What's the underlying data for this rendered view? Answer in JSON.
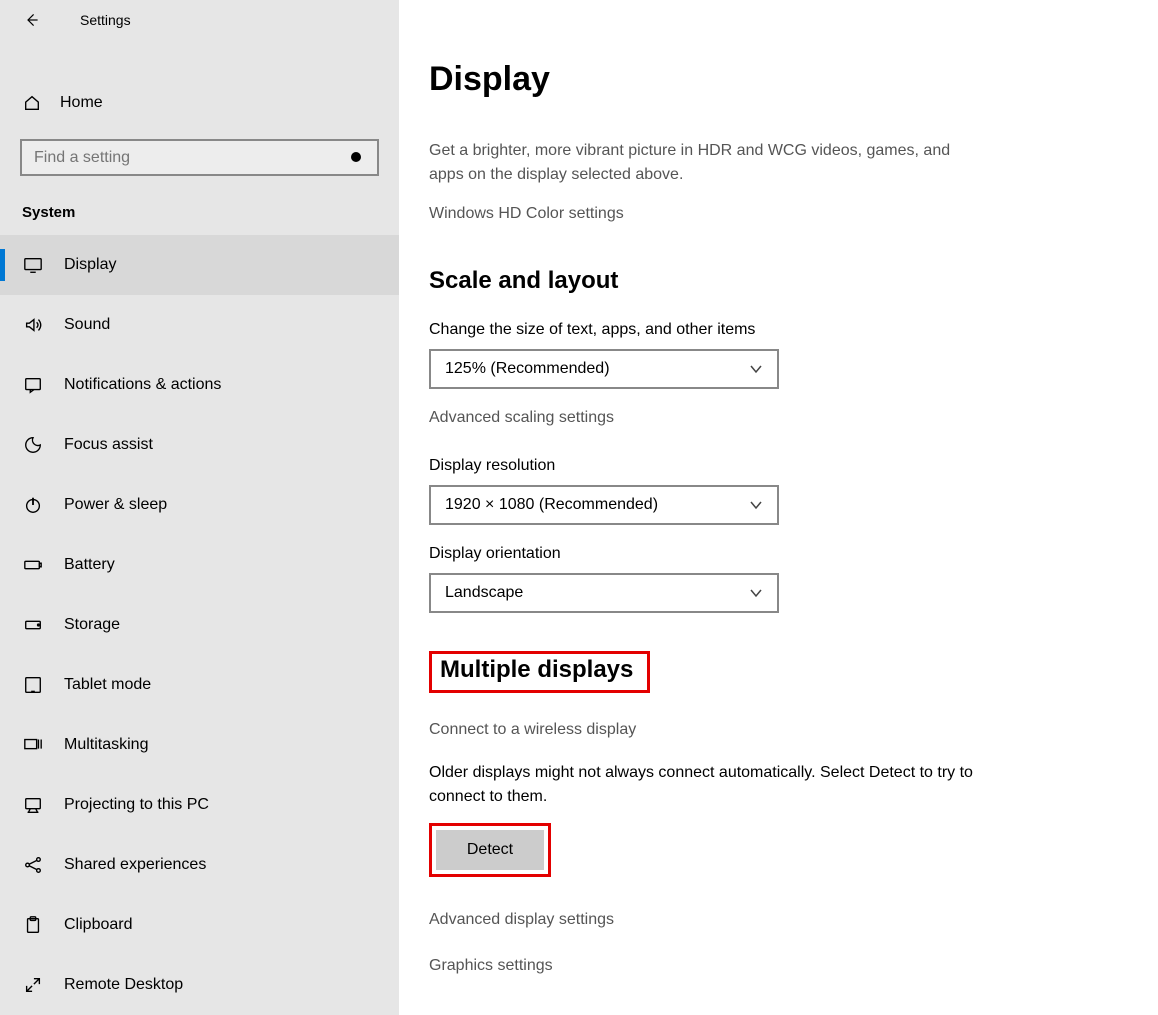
{
  "app_title": "Settings",
  "home_label": "Home",
  "search_placeholder": "Find a setting",
  "category_label": "System",
  "nav": [
    {
      "label": "Display",
      "icon": "display-icon",
      "active": true
    },
    {
      "label": "Sound",
      "icon": "sound-icon"
    },
    {
      "label": "Notifications & actions",
      "icon": "notifications-icon"
    },
    {
      "label": "Focus assist",
      "icon": "focus-assist-icon"
    },
    {
      "label": "Power & sleep",
      "icon": "power-icon"
    },
    {
      "label": "Battery",
      "icon": "battery-icon"
    },
    {
      "label": "Storage",
      "icon": "storage-icon"
    },
    {
      "label": "Tablet mode",
      "icon": "tablet-icon"
    },
    {
      "label": "Multitasking",
      "icon": "multitasking-icon"
    },
    {
      "label": "Projecting to this PC",
      "icon": "projecting-icon"
    },
    {
      "label": "Shared experiences",
      "icon": "shared-icon"
    },
    {
      "label": "Clipboard",
      "icon": "clipboard-icon"
    },
    {
      "label": "Remote Desktop",
      "icon": "remote-icon"
    }
  ],
  "page_title": "Display",
  "hdr_desc": "Get a brighter, more vibrant picture in HDR and WCG videos, games, and apps on the display selected above.",
  "hd_color_link": "Windows HD Color settings",
  "scale_section": "Scale and layout",
  "scale_label": "Change the size of text, apps, and other items",
  "scale_value": "125% (Recommended)",
  "advanced_scaling_link": "Advanced scaling settings",
  "resolution_label": "Display resolution",
  "resolution_value": "1920 × 1080 (Recommended)",
  "orientation_label": "Display orientation",
  "orientation_value": "Landscape",
  "multiple_section": "Multiple displays",
  "wireless_link": "Connect to a wireless display",
  "older_text": "Older displays might not always connect automatically. Select Detect to try to connect to them.",
  "detect_label": "Detect",
  "advanced_display_link": "Advanced display settings",
  "graphics_link": "Graphics settings"
}
